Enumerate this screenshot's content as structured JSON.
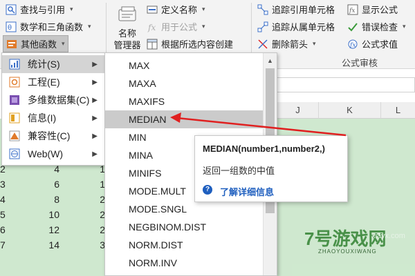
{
  "ribbon": {
    "left": {
      "lookup": "查找与引用",
      "math": "数学和三角函数",
      "more": "其他函数"
    },
    "name_manager": {
      "line1": "名称",
      "line2": "管理器"
    },
    "define": {
      "define_name": "定义名称",
      "use_in_formula": "用于公式",
      "create_from_selection": "根据所选内容创建"
    },
    "audit": {
      "trace_precedents": "追踪引用单元格",
      "trace_dependents": "追踪从属单元格",
      "remove_arrows": "删除箭头",
      "show_formulas": "显示公式",
      "error_checking": "错误检查",
      "evaluate_formula": "公式求值",
      "group_label": "公式审核"
    }
  },
  "sheet": {
    "columns": [
      "J",
      "K",
      "L"
    ],
    "rows": [
      {
        "row": "2",
        "a": "4",
        "b": "1"
      },
      {
        "row": "3",
        "a": "6",
        "b": "1"
      },
      {
        "row": "4",
        "a": "8",
        "b": "2"
      },
      {
        "row": "5",
        "a": "10",
        "b": "2"
      },
      {
        "row": "6",
        "a": "12",
        "b": "2"
      },
      {
        "row": "7",
        "a": "14",
        "b": "3"
      }
    ]
  },
  "more_functions_menu": {
    "items": [
      {
        "label": "统计(S)",
        "icon": "chart-icon",
        "color": "#3b6fc9"
      },
      {
        "label": "工程(E)",
        "icon": "engineering-icon",
        "color": "#e07a2a"
      },
      {
        "label": "多维数据集(C)",
        "icon": "cube-icon",
        "color": "#7a4fb0"
      },
      {
        "label": "信息(I)",
        "icon": "info-icon",
        "color": "#e0a020"
      },
      {
        "label": "兼容性(C)",
        "icon": "warning-icon",
        "color": "#e07a2a"
      },
      {
        "label": "Web(W)",
        "icon": "web-icon",
        "color": "#3b6fc9"
      }
    ]
  },
  "stat_functions": [
    "MAX",
    "MAXA",
    "MAXIFS",
    "MEDIAN",
    "MIN",
    "MINA",
    "MINIFS",
    "MODE.MULT",
    "MODE.SNGL",
    "NEGBINOM.DIST",
    "NORM.DIST",
    "NORM.INV"
  ],
  "tooltip": {
    "signature": "MEDIAN(number1,number2,)",
    "description": "返回一组数的中值",
    "help_link": "了解详细信息"
  },
  "watermark": {
    "text": "7号游戏网",
    "subtext": "ZHAOYOUXIWANG",
    "url": "xiayx.com"
  },
  "colors": {
    "ribbon_bg": "#f3f3f3",
    "sheet_green": "#cfe8cf",
    "arrow": "#e02020",
    "selected": "#cbcbcb",
    "link_blue": "#1f5fbf"
  }
}
